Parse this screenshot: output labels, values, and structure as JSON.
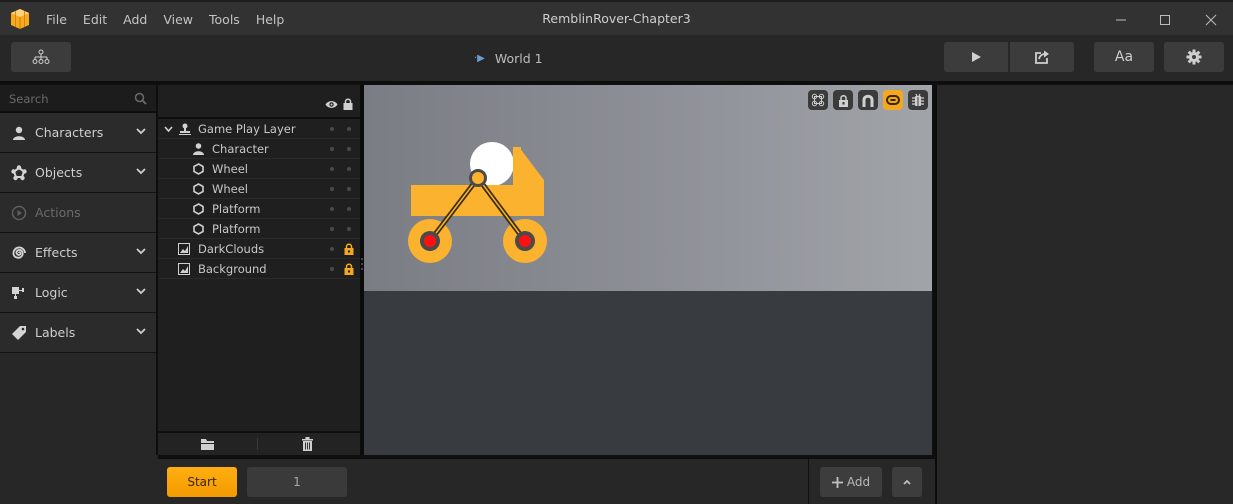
{
  "window": {
    "title": "RemblinRover-Chapter3",
    "menu": [
      "File",
      "Edit",
      "Add",
      "View",
      "Tools",
      "Help"
    ],
    "controls": [
      "minimize-icon",
      "maximize-icon",
      "close-icon"
    ]
  },
  "toolbar": {
    "hierarchy_icon": "hierarchy-icon",
    "breadcrumb": "World 1",
    "play_icon": "play-icon",
    "replay_icon": "replay-icon",
    "font_label": "Aa",
    "settings_icon": "gear-icon"
  },
  "library": {
    "search_placeholder": "Search",
    "items": [
      {
        "label": "Characters",
        "icon": "person-icon",
        "expandable": true,
        "enabled": true
      },
      {
        "label": "Objects",
        "icon": "objects-icon",
        "expandable": true,
        "enabled": true
      },
      {
        "label": "Actions",
        "icon": "play-circle-icon",
        "expandable": false,
        "enabled": false
      },
      {
        "label": "Effects",
        "icon": "spiral-icon",
        "expandable": true,
        "enabled": true
      },
      {
        "label": "Logic",
        "icon": "puzzle-icon",
        "expandable": true,
        "enabled": true
      },
      {
        "label": "Labels",
        "icon": "tag-icon",
        "expandable": true,
        "enabled": true
      }
    ]
  },
  "layers": {
    "header_icons": [
      "eye-icon",
      "lock-icon"
    ],
    "rows": [
      {
        "label": "Game Play Layer",
        "icon": "layer-icon",
        "indent": 0,
        "expanded": true,
        "locked": false
      },
      {
        "label": "Character",
        "icon": "person-icon",
        "indent": 1,
        "locked": false
      },
      {
        "label": "Wheel",
        "icon": "hexagon-icon",
        "indent": 1,
        "locked": false
      },
      {
        "label": "Wheel",
        "icon": "hexagon-icon",
        "indent": 1,
        "locked": false
      },
      {
        "label": "Platform",
        "icon": "hexagon-icon",
        "indent": 1,
        "locked": false
      },
      {
        "label": "Platform",
        "icon": "hexagon-icon",
        "indent": 1,
        "locked": false
      },
      {
        "label": "DarkClouds",
        "icon": "image-icon",
        "indent": 0,
        "locked": true
      },
      {
        "label": "Background",
        "icon": "image-icon",
        "indent": 0,
        "locked": true
      }
    ],
    "footer_icons": [
      "folder-icon",
      "trash-icon"
    ]
  },
  "stage": {
    "tools": [
      {
        "name": "joints-icon",
        "active": false
      },
      {
        "name": "lock-icon",
        "active": false
      },
      {
        "name": "magnet-icon",
        "active": false
      },
      {
        "name": "link-icon",
        "active": true
      },
      {
        "name": "bug-icon",
        "active": false
      }
    ],
    "colors": {
      "accent": "#f4a81f",
      "body": "#fbb22f",
      "axle": "#ff0000",
      "sky": "#8e9197",
      "ground": "#383b40"
    }
  },
  "bottombar": {
    "start_label": "Start",
    "scene_value": "1",
    "add_label": "Add",
    "up_icon": "chevron-up-icon"
  }
}
